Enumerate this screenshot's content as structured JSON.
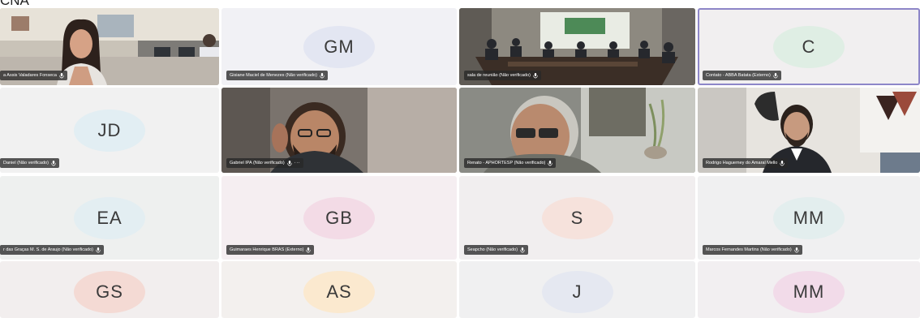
{
  "top_label": "CNA",
  "colors": {
    "tile_bg": "#efeceb",
    "name_tag_bg": "#2b2b2b",
    "selected_border": "#8d86c8"
  },
  "participants": [
    {
      "name": "a Assis Valadares Fonseca",
      "type": "video",
      "initials": ""
    },
    {
      "name": "Gisiane Maciel de Menezes (Não verificado)",
      "type": "avatar",
      "initials": "GM",
      "avatar_color": "#e3e6f2",
      "tile_color": "#f1f1f5"
    },
    {
      "name": "sala de reunião (Não verificado)",
      "type": "video",
      "initials": ""
    },
    {
      "name": "Contato - ABBA Batata (Externo)",
      "type": "avatar",
      "initials": "C",
      "avatar_color": "#dfeee4",
      "tile_color": "#f1eff0"
    },
    {
      "name": "Daniel (Não verificado)",
      "type": "avatar",
      "initials": "JD",
      "avatar_color": "#e2eef3",
      "tile_color": "#f1f1f1"
    },
    {
      "name": "Gabriel IPA (Não verificado)",
      "type": "video",
      "initials": ""
    },
    {
      "name": "Renato - APHORTESP (Não verificado)",
      "type": "video",
      "initials": ""
    },
    {
      "name": "Rodrigo Haguemey do Amaral Mello",
      "type": "video",
      "initials": ""
    },
    {
      "name": "r das Graças M. S. de Araujo (Não verificado)",
      "type": "avatar",
      "initials": "EA",
      "avatar_color": "#e3eef2",
      "tile_color": "#eef0ef"
    },
    {
      "name": "Guimaraes Henrique BRAS (Externo)",
      "type": "avatar",
      "initials": "GB",
      "avatar_color": "#f3dbe6",
      "tile_color": "#f5eef1"
    },
    {
      "name": "Seapcho (Não verificado)",
      "type": "avatar",
      "initials": "S",
      "avatar_color": "#f6e2dc",
      "tile_color": "#f1eeef"
    },
    {
      "name": "Marcos Fernandes Martins (Não verificado)",
      "type": "avatar",
      "initials": "MM",
      "avatar_color": "#e3eeee",
      "tile_color": "#f0f0f1"
    },
    {
      "name": "",
      "type": "avatar",
      "initials": "GS",
      "avatar_color": "#f4dad4",
      "tile_color": "#f2eeee"
    },
    {
      "name": "",
      "type": "avatar",
      "initials": "AS",
      "avatar_color": "#fbe9cf",
      "tile_color": "#f3f0ee"
    },
    {
      "name": "",
      "type": "avatar",
      "initials": "J",
      "avatar_color": "#e5e8f1",
      "tile_color": "#f0f0f1"
    },
    {
      "name": "",
      "type": "avatar",
      "initials": "MM",
      "avatar_color": "#f2dbe9",
      "tile_color": "#f2eff1"
    }
  ]
}
